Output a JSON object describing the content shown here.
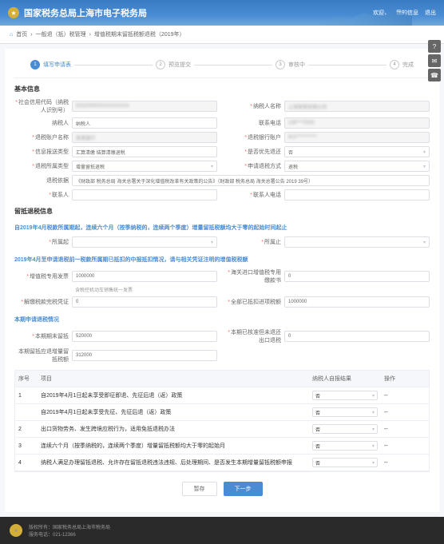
{
  "header": {
    "title": "国家税务总局上海市电子税务局",
    "welcome": "欢迎，",
    "menu": [
      "我的信息",
      "退出"
    ]
  },
  "breadcrumb": {
    "home": "首页",
    "items": [
      "一般退（抵）税管理",
      "增值税期末留抵税额退税（2019年）"
    ]
  },
  "steps": [
    {
      "num": "1",
      "label": "填写申请表",
      "active": true
    },
    {
      "num": "2",
      "label": "预览提交"
    },
    {
      "num": "3",
      "label": "审核中"
    },
    {
      "num": "4",
      "label": "完成"
    }
  ],
  "section_basic": "基本信息",
  "fields": {
    "credit_code": {
      "label": "社会信用代码（纳税人识别号）",
      "value": "91310000XXXXXXXXXX"
    },
    "taxpayer_name": {
      "label": "纳税人名称",
      "value": "上海某某有限公司"
    },
    "taxpayer_type": {
      "label": "纳税人",
      "value": "纳税人"
    },
    "contact": {
      "label": "联系电话",
      "value": "138****0000"
    },
    "bank_name": {
      "label": "退税账户名称",
      "value": "某某银行"
    },
    "bank_account": {
      "label": "退税银行账户",
      "value": "622***********"
    },
    "info_type": {
      "label": "信息报送类型",
      "value": "汇算清缴  结算清缴退税"
    },
    "priority": {
      "label": "是否优先退还",
      "value": "否"
    },
    "apply_type": {
      "label": "退税所属类型",
      "value": "增量留抵退税"
    },
    "refund_way": {
      "label": "申请退税方式",
      "value": "退税"
    },
    "policy": {
      "label": "退税依据",
      "value": "《财政部 税务总局 海关总署关于深化增值税改革有关政策的公告》（财政部 税务总局 海关总署公告 2019 39号）"
    },
    "contact_name": {
      "label": "联系人",
      "value": ""
    },
    "contact_phone": {
      "label": "联系人电话",
      "value": ""
    }
  },
  "section_cred": "留抵退税信息",
  "blue1": "自2019年4月税款所属期起，连续六个月（按季纳税的，连续两个季度）增量留抵税额均大于零的起始时间起止",
  "period": {
    "start_lbl": "所属起",
    "end_lbl": "所属止",
    "start_val": "",
    "end_val": ""
  },
  "blue2": "2019年4月至申请退税前一税款所属期已抵扣的中报抵扣情况，请与相关凭证注明的增值税税额",
  "dedu": {
    "vat_special": {
      "label": "增值税专用发票",
      "note": "含税控机动车销售统一发票",
      "value": "1000000"
    },
    "customs": {
      "label": "海关进口增值税专用缴款书",
      "value": "0"
    },
    "paid": {
      "label": "解缴税款完税凭证",
      "value": "0"
    },
    "period_total": {
      "label": "全部已抵扣进项税额",
      "value": "1000000"
    }
  },
  "section_apply": "本期申请退税情况",
  "apply": {
    "current_end": {
      "label": "本期期末留抵",
      "value": "520000"
    },
    "prev_end": {
      "label": "本期已核准但未退还出口退税",
      "value": "0"
    },
    "inc": {
      "label": "本期留抵应退增量留抵税额",
      "value": "312000"
    }
  },
  "table": {
    "headers": [
      "序号",
      "项目",
      "纳税人自报结果",
      "操作"
    ],
    "rows": [
      {
        "no": "1",
        "item": "自2019年4月1日起未享受即征即退、先征后退（返）政策",
        "val": "否",
        "op": "--"
      },
      {
        "no": "",
        "item": "自2019年4月1日起未享受先征、先征后退（返）政策",
        "val": "否",
        "op": "--"
      },
      {
        "no": "2",
        "item": "出口货物劳务、发生跨境应税行为，适用免抵退税办法",
        "val": "否",
        "op": "--"
      },
      {
        "no": "3",
        "item": "连续六个月（按季纳税的，连续两个季度）增量留抵税额均大于零的起始月",
        "val": "否",
        "op": "--"
      },
      {
        "no": "4",
        "item": "纳税人满足办理留抵退税、允许存在留抵退税违法违规、后处理期间、是否发生本期增量留抵税额申报",
        "val": "否",
        "op": "--"
      }
    ]
  },
  "buttons": {
    "save": "暂存",
    "next": "下一步"
  },
  "footer": {
    "copyright": "版权所有：国家税务总局上海市税务局",
    "service": "服务电话：021-12366"
  }
}
